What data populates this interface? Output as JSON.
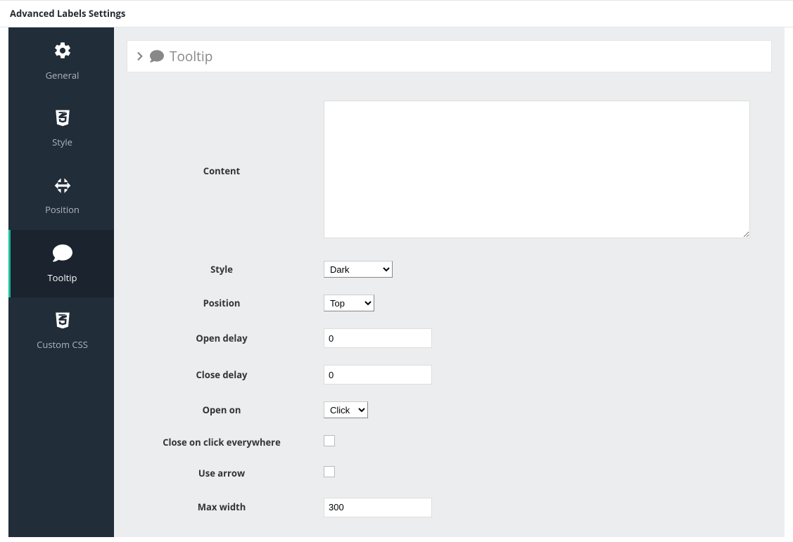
{
  "header": {
    "title": "Advanced Labels Settings"
  },
  "sidebar": {
    "items": [
      {
        "label": "General"
      },
      {
        "label": "Style"
      },
      {
        "label": "Position"
      },
      {
        "label": "Tooltip"
      },
      {
        "label": "Custom CSS"
      }
    ],
    "active_index": 3
  },
  "panel": {
    "title": "Tooltip"
  },
  "form": {
    "content": {
      "label": "Content",
      "value": ""
    },
    "style": {
      "label": "Style",
      "value": "Dark"
    },
    "position": {
      "label": "Position",
      "value": "Top"
    },
    "open_delay": {
      "label": "Open delay",
      "value": "0"
    },
    "close_delay": {
      "label": "Close delay",
      "value": "0"
    },
    "open_on": {
      "label": "Open on",
      "value": "Click"
    },
    "close_everywhere": {
      "label": "Close on click everywhere",
      "checked": false
    },
    "use_arrow": {
      "label": "Use arrow",
      "checked": false
    },
    "max_width": {
      "label": "Max width",
      "value": "300"
    }
  }
}
